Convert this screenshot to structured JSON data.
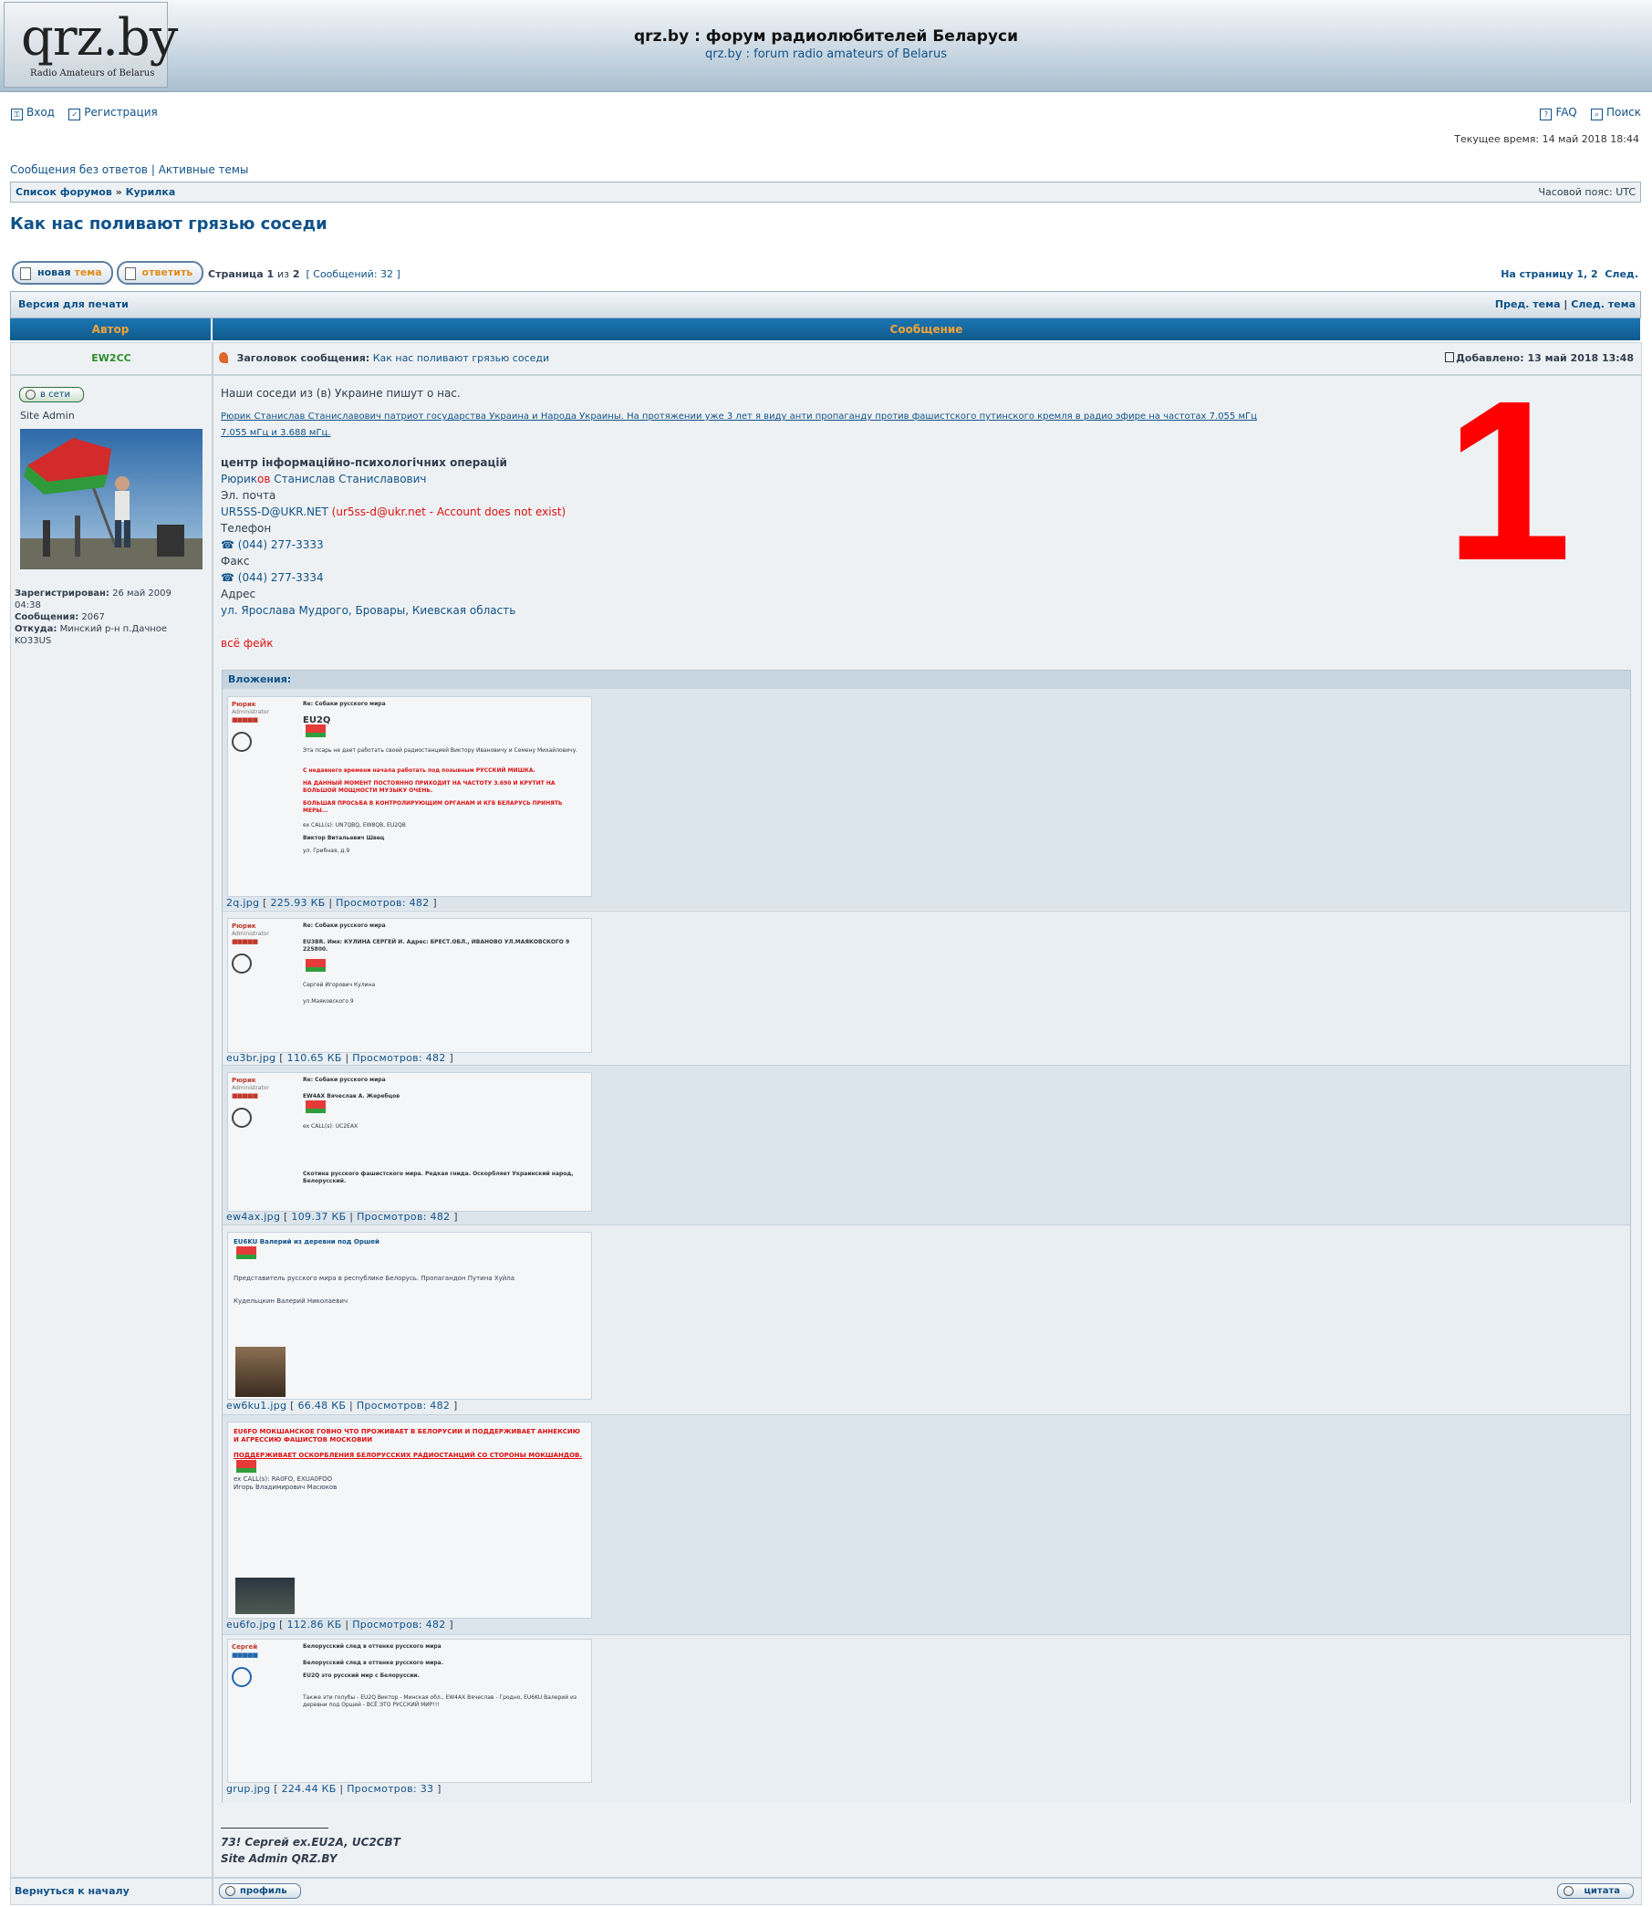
{
  "header": {
    "logo_main": "qrz.by",
    "logo_sub": "Radio Amateurs of Belarus",
    "title": "qrz.by : форум радиолюбителей Беларуси",
    "subtitle": "qrz.by : forum radio amateurs of Belarus"
  },
  "topnav": {
    "login": "Вход",
    "register": "Регистрация",
    "faq": "FAQ",
    "search": "Поиск",
    "current_time": "Текущее время: 14 май 2018 18:44"
  },
  "quicklinks": {
    "unanswered": "Сообщения без ответов",
    "sep": "|",
    "active": "Активные темы"
  },
  "breadcrumb": {
    "forum_list": "Список форумов",
    "arrow": "»",
    "forum": "Курилка",
    "timezone": "Часовой пояс: UTC"
  },
  "topic_title": "Как нас поливают грязью соседи",
  "pagination": {
    "new_topic_a": "новая",
    "new_topic_b": "тема",
    "reply": "ответить",
    "page_info_pre": "Страница",
    "page_cur": "1",
    "page_of": "из",
    "page_total": "2",
    "count": "[ Сообщений: 32 ]",
    "goto": "На страницу",
    "p1": "1",
    "p2": "2",
    "next": "След."
  },
  "topicbar": {
    "print": "Версия для печати",
    "prev": "Пред. тема",
    "sep": "|",
    "next": "След. тема"
  },
  "table": {
    "col_author": "Автор",
    "col_message": "Сообщение"
  },
  "post": {
    "author": "EW2CC",
    "subject_label": "Заголовок сообщения:",
    "subject": "Как нас поливают грязью соседи",
    "posted": "Добавлено: 13 май 2018 13:48",
    "online": "в сети",
    "rank": "Site Admin",
    "registered_label": "Зарегистрирован:",
    "registered_date": "26 май 2009",
    "registered_time": "04:38",
    "posts_label": "Сообщения:",
    "posts": "2067",
    "from_label": "Откуда:",
    "from": "Минский р-н п.Дачное",
    "from2": "KO33US",
    "big_number": "1",
    "lines": {
      "intro": "Наши соседи из (в) Украине пишут о нас.",
      "link": "Рюрик Станислав Станиславович патриот государства Украина и Народа Украины. На протяжении уже 3 лет я виду анти пропаганду против фашистского путинского кремля в радио эфире на частотах 7.055 мГц 7.055 мГц и 3.688 мГц.",
      "center": "центр інформаційно-психологічних операцій",
      "name_a": "Рюрик",
      "name_b": "ов",
      "name_c": " Станислав Станиславович",
      "email_label": "Эл. почта",
      "email": "UR5SS-D@UKR.NET",
      "email_note": "(ur5ss-d@ukr.net - Account does not exist)",
      "phone_label": "Телефон",
      "phone": "(044) 277-3333",
      "fax_label": "Факс",
      "fax": "(044) 277-3334",
      "addr_label": "Адрес",
      "addr": "ул. Ярослава Мудрого, Бровары, Киевская область",
      "fake": "всё фейк"
    },
    "attach_header": "Вложения:",
    "attachments": [
      {
        "file": "2q.jpg",
        "size": "225.93 КБ",
        "views": "Просмотров: 482"
      },
      {
        "file": "eu3br.jpg",
        "size": "110.65 КБ",
        "views": "Просмотров: 482"
      },
      {
        "file": "ew4ax.jpg",
        "size": "109.37 КБ",
        "views": "Просмотров: 482"
      },
      {
        "file": "ew6ku1.jpg",
        "size": "66.48 КБ",
        "views": "Просмотров: 482"
      },
      {
        "file": "eu6fo.jpg",
        "size": "112.86 КБ",
        "views": "Просмотров: 482"
      },
      {
        "file": "grup.jpg",
        "size": "224.44 КБ",
        "views": "Просмотров: 33"
      }
    ],
    "sig1": "73! Сергей ex.EU2A, UC2CBT",
    "sig2": "Site Admin QRZ.BY"
  },
  "shots": {
    "s1_user": "Рюрик",
    "s1_role": "Administrator",
    "s1_title": "Re: Собаки русского мира",
    "s1_call": "EU2Q",
    "s1_t1": "Эта псарь не дает работать своей радиостанцией Виктору Ивановичу и Семену Михайловичу.",
    "s1_red1": "С недавнего времени начала работать под позывным РУССКИЙ МИШКА.",
    "s1_red2": "НА ДАННЫЙ МОМЕНТ ПОСТОЯННО ПРИХОДИТ НА ЧАСТОТУ 3.690 И КРУТИТ НА БОЛЬШОЙ МОЩНОСТИ МУЗЫКУ ОЧЕНЬ.",
    "s1_red3": "БОЛЬШАЯ ПРОСЬБА В КОНТРОЛИРУЮЩИМ ОРГАНАМ И КГБ БЕЛАРУСЬ ПРИНЯТЬ МЕРЫ...",
    "s1_ex": "ex CALL(s): UN7QBQ, EW8QB, EU2QB",
    "s1_name": "Виктор Витальевич Швец",
    "s1_addr": "ул. Грибная, д.9",
    "s2_text": "EU3BR. Имя: КУЛИНА СЕРГЕЙ И.  Адрес: БРЕСТ.ОБЛ., ИВАНОВО УЛ.МАЯКОВСКОГО 9 225800.",
    "s2_name": "Сергей Игорович Кулина",
    "s2_addr": "ул.Маяковского 9",
    "s3_text": "EW4AX Вячеслав А. Жеребцов",
    "s3_ex": "ex CALL(s): UC2EAX",
    "s3_red": "Скотина русского фашистского мира. Редкая гнида. Оскорбляет Украинский народ, Белорусский.",
    "s4_text": "EU6KU Валерий из деревни под Оршей",
    "s4_desc": "Представитель русского мира в республике Белорусь. Пропагандон Путина Хуйла",
    "s4_name": "Кудельцкин Валерий Николаевич",
    "s5_red1": "EU6FO МОКШАНСКОЕ ГОВНО ЧТО ПРОЖИВАЕТ В БЕЛОРУСИИ И ПОДДЕРЖИВАЕТ АННЕКСИЮ И АГРЕССИЮ ФАШИСТОВ МОСКОВИИ",
    "s5_red2": "ПОДДЕРЖИВАЕТ ОСКОРБЛЕНИЯ БЕЛОРУССКИХ РАДИОСТАНЦИЙ СО СТОРОНЫ МОКШАНДОВ.",
    "s5_ex": "ex CALL(s): RA0FO, EXUA0FOO",
    "s5_name": "Игорь Владимирович Масюков",
    "s6_user": "Сергей",
    "s6_title": "Белорусский след в оттенке русского мира",
    "s6_t1": "Белорусский след в оттенке русского мира.",
    "s6_t2": "EU2Q это русский мир с Белоруссии.",
    "s6_t3": "Также эти голубы - EU2Q Виктор - Минская обл., EW4AX Вячеслав - Гродно, EU6KU Валерий из деревни под Оршей - ВСЁ ЭТО РУССКИЙ МИР!!!"
  },
  "footer": {
    "back_top": "Вернуться к началу",
    "profile": "профиль",
    "quote": "цитата"
  }
}
